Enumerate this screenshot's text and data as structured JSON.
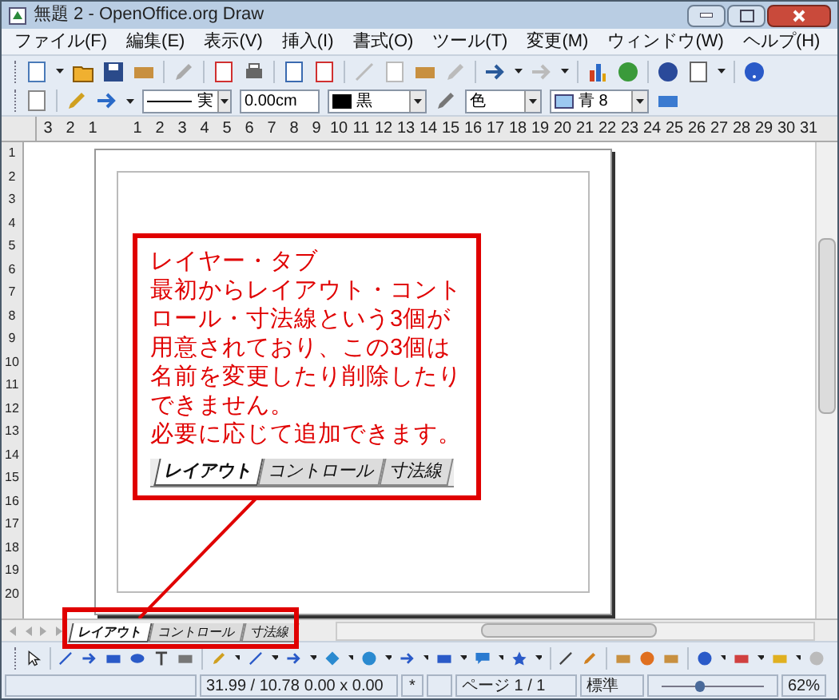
{
  "window": {
    "title": "無題 2 - OpenOffice.org Draw"
  },
  "menu": [
    "ファイル(F)",
    "編集(E)",
    "表示(V)",
    "挿入(I)",
    "書式(O)",
    "ツール(T)",
    "変更(M)",
    "ウィンドウ(W)",
    "ヘルプ(H)"
  ],
  "line_toolbar": {
    "line_style": "実",
    "line_width": "0.00cm",
    "line_color": "黒",
    "area_style": "色",
    "area_fill": "青 8"
  },
  "ruler": [
    "3",
    "2",
    "1",
    "1",
    "2",
    "3",
    "4",
    "5",
    "6",
    "7",
    "8",
    "9",
    "10",
    "11",
    "12",
    "13",
    "14",
    "15",
    "16",
    "17",
    "18",
    "19",
    "20",
    "21",
    "22",
    "23",
    "24",
    "25",
    "26",
    "27",
    "28",
    "29",
    "30",
    "31"
  ],
  "vertical_ruler": [
    "1",
    "2",
    "3",
    "4",
    "5",
    "6",
    "7",
    "8",
    "9",
    "10",
    "11",
    "12",
    "13",
    "14",
    "15",
    "16",
    "17",
    "18",
    "19",
    "20"
  ],
  "callout": {
    "lines": [
      "レイヤー・タブ",
      "最初からレイアウト・コント",
      "ロール・寸法線という3個が",
      "用意されており、この3個は",
      "名前を変更したり削除したり",
      "できません。",
      "必要に応じて追加できます。"
    ],
    "tabs": [
      {
        "label": "レイアウト",
        "selected": true
      },
      {
        "label": "コントロール",
        "selected": false
      },
      {
        "label": "寸法線",
        "selected": false
      }
    ]
  },
  "layer_tabs": [
    {
      "label": "レイアウト",
      "selected": true
    },
    {
      "label": "コントロール",
      "selected": false
    },
    {
      "label": "寸法線",
      "selected": false
    }
  ],
  "status_bar": {
    "position": "31.99 / 10.78",
    "size": "0.00 x 0.00",
    "modified": "*",
    "page": "ページ 1 / 1",
    "style": "標準",
    "zoom": {
      "level": 0.35
    },
    "zoom_percent": "62%"
  }
}
